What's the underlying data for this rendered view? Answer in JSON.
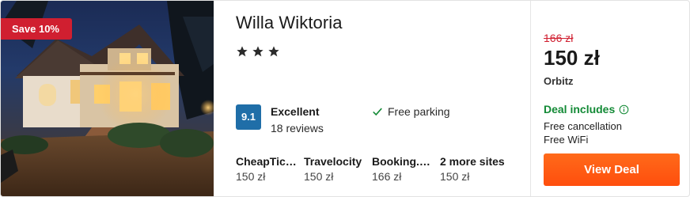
{
  "hotel": {
    "name": "Willa Wiktoria",
    "star_count": 3,
    "discount_badge": "Save 10%",
    "rating": {
      "score": "9.1",
      "label": "Excellent",
      "reviews": "18 reviews"
    },
    "amenities": [
      "Free parking"
    ]
  },
  "sites": [
    {
      "name": "CheapTic…",
      "price": "150 zł"
    },
    {
      "name": "Travelocity",
      "price": "150 zł"
    },
    {
      "name": "Booking.…",
      "price": "166 zł"
    },
    {
      "name": "2 more sites",
      "price": "150 zł"
    }
  ],
  "deal": {
    "old_price": "166 zł",
    "price": "150 zł",
    "provider": "Orbitz",
    "includes_label": "Deal includes",
    "perks": [
      "Free cancellation",
      "Free WiFi"
    ],
    "button_label": "View Deal"
  },
  "icons": {
    "star": "star-icon",
    "check": "check-icon",
    "chevron": "chevron-down-icon",
    "info": "info-icon"
  },
  "colors": {
    "badge": "#d01f30",
    "rating_box": "#1f6ea8",
    "deal_green": "#138a36",
    "old_price": "#d01f30",
    "button": "#ff5a14"
  }
}
